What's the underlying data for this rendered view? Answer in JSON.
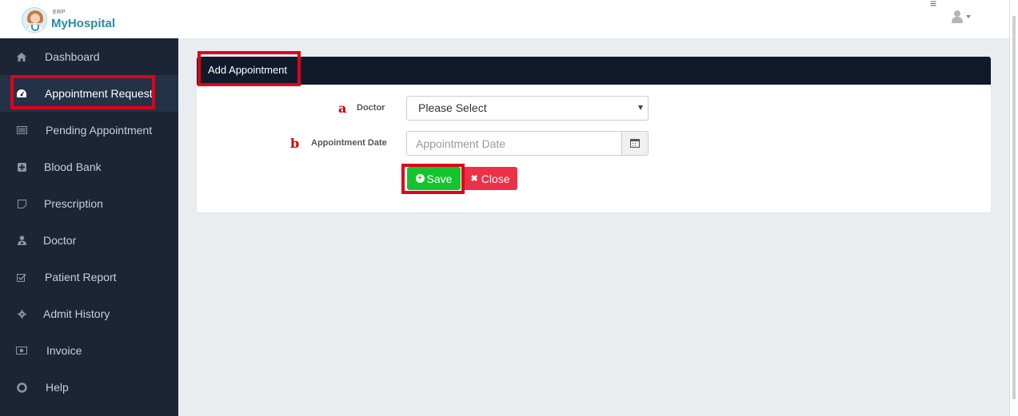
{
  "header": {
    "logo_small": "ERP",
    "logo_name": "MyHospital",
    "menu_icon": "hamburger-icon",
    "user_icon": "user-icon"
  },
  "sidebar": {
    "items": [
      {
        "label": "Dashboard",
        "icon": "home-icon"
      },
      {
        "label": "Appointment Request",
        "icon": "dashboard-gauge-icon"
      },
      {
        "label": "Pending Appointment",
        "icon": "list-icon"
      },
      {
        "label": "Blood Bank",
        "icon": "plus-square-icon"
      },
      {
        "label": "Prescription",
        "icon": "note-icon"
      },
      {
        "label": "Doctor",
        "icon": "user-md-icon"
      },
      {
        "label": "Patient Report",
        "icon": "check-square-icon"
      },
      {
        "label": "Admit History",
        "icon": "gear-icon"
      },
      {
        "label": "Invoice",
        "icon": "money-icon"
      },
      {
        "label": "Help",
        "icon": "life-ring-icon"
      }
    ],
    "active_index": 1
  },
  "form": {
    "title": "Add Appointment",
    "doctor_marker": "a",
    "doctor_label": "Doctor",
    "doctor_value": "Please Select",
    "date_marker": "b",
    "date_label": "Appointment Date",
    "date_placeholder": "Appointment Date",
    "save_label": "Save",
    "close_label": "Close"
  },
  "colors": {
    "sidebar_bg": "#1b2535",
    "header_bar": "#111a2b",
    "save": "#13c42e",
    "close": "#ee3047",
    "annotation": "#e0001b"
  }
}
